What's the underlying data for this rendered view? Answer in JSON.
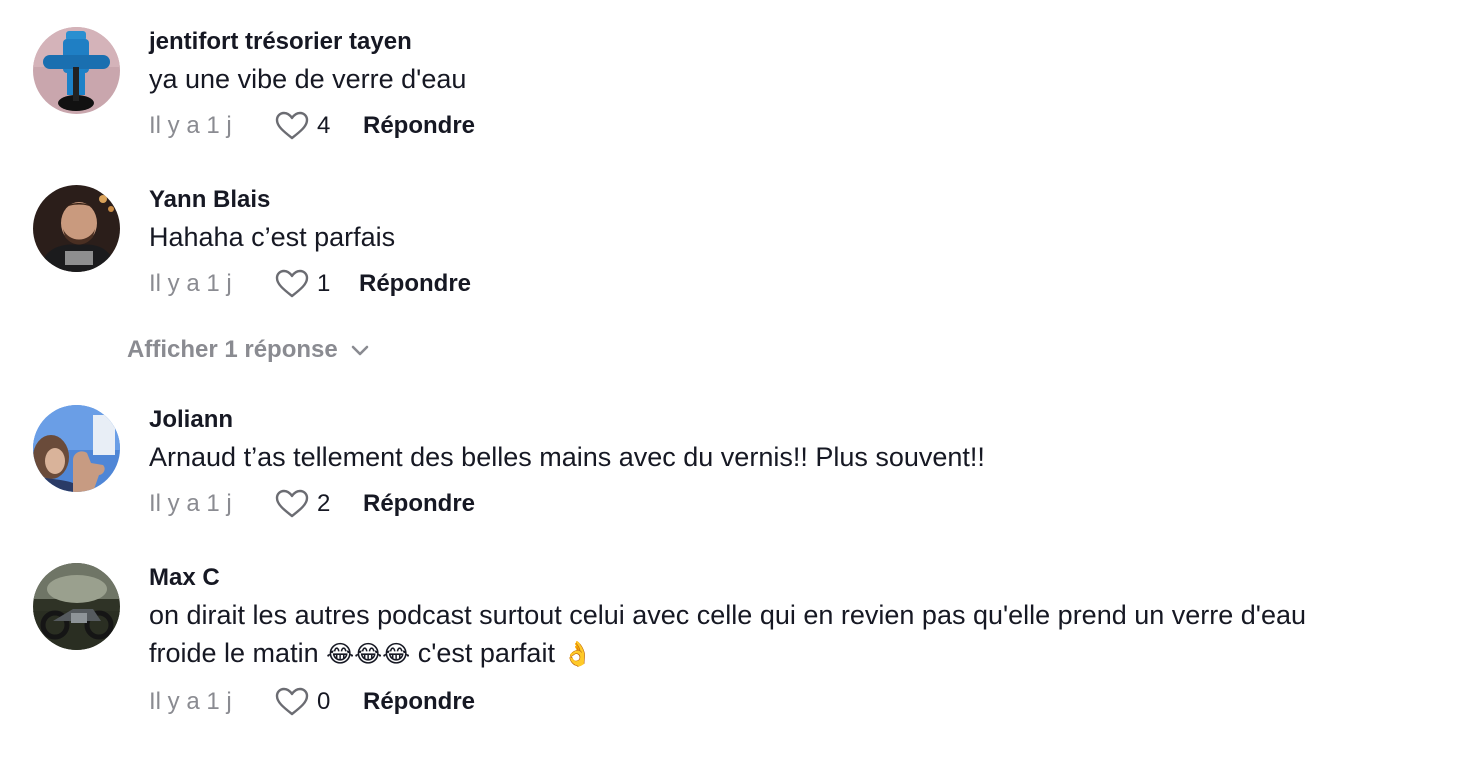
{
  "comments": [
    {
      "username": "jentifort trésorier tayen",
      "text": "ya une vibe de verre d'eau",
      "time": "Il y a 1 j",
      "likes": "4",
      "reply_label": "Répondre"
    },
    {
      "username": "Yann Blais",
      "text": "Hahaha c’est parfais",
      "time": "Il y a 1 j",
      "likes": "1",
      "reply_label": "Répondre"
    },
    {
      "username": "Joliann",
      "text": "Arnaud t’as tellement des belles mains avec du vernis!! Plus souvent!!",
      "time": "Il y a 1 j",
      "likes": "2",
      "reply_label": "Répondre"
    },
    {
      "username": "Max C",
      "text_line1": "on dirait les autres podcast surtout celui avec celle qui en revien pas qu'elle prend un verre d'eau",
      "text_line2_a": "froide le matin ",
      "text_line2_emoji": "😂😂😂",
      "text_line2_b": " c'est parfait ",
      "text_line2_emoji2": "👌",
      "time": "Il y a 1 j",
      "likes": "0",
      "reply_label": "Répondre"
    }
  ],
  "view_replies": "Afficher 1 réponse",
  "icons": {
    "like": "heart-outline-icon",
    "expand": "chevron-down-icon"
  },
  "colors": {
    "text": "#161823",
    "muted": "#8a8b91"
  }
}
